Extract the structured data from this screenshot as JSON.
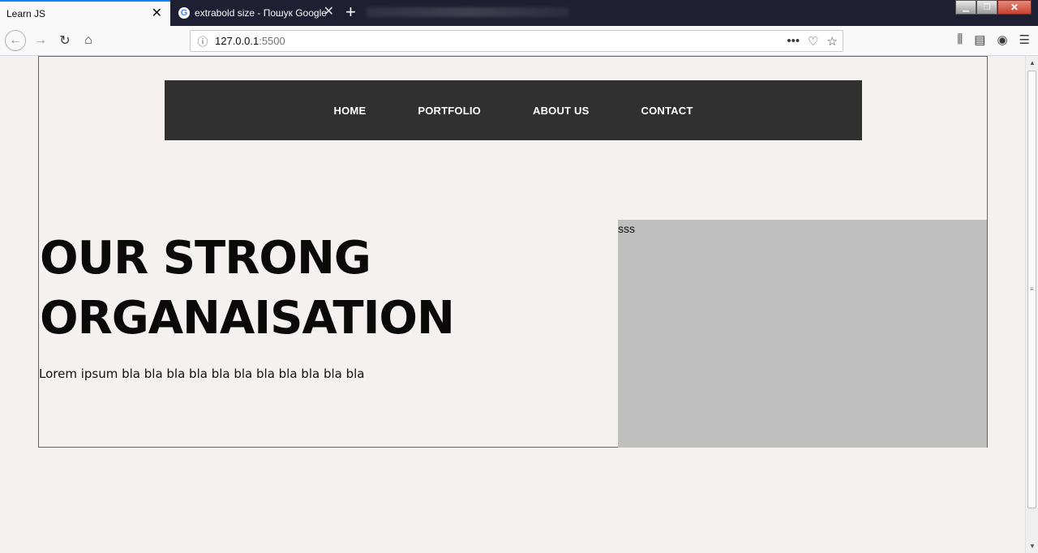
{
  "browser": {
    "tabs": [
      {
        "title": "Learn JS",
        "active": true
      },
      {
        "title": "extrabold size - Пошук Google",
        "active": false
      }
    ],
    "url": {
      "host": "127.0.0.1",
      "port": ":5500"
    },
    "accent_color": "#0a84ff"
  },
  "nav": {
    "items": [
      "HOME",
      "PORTFOLIO",
      "ABOUT US",
      "CONTACT"
    ],
    "background": "#303030"
  },
  "hero": {
    "title_line1": "OUR STRONG",
    "title_line2": "ORGANAISATION",
    "text": "Lorem ipsum bla bla bla bla bla bla bla bla bla bla bla"
  },
  "side_box": {
    "text": "sss",
    "background": "#bfbfbf"
  },
  "container_border_color": "#2e8b2e"
}
